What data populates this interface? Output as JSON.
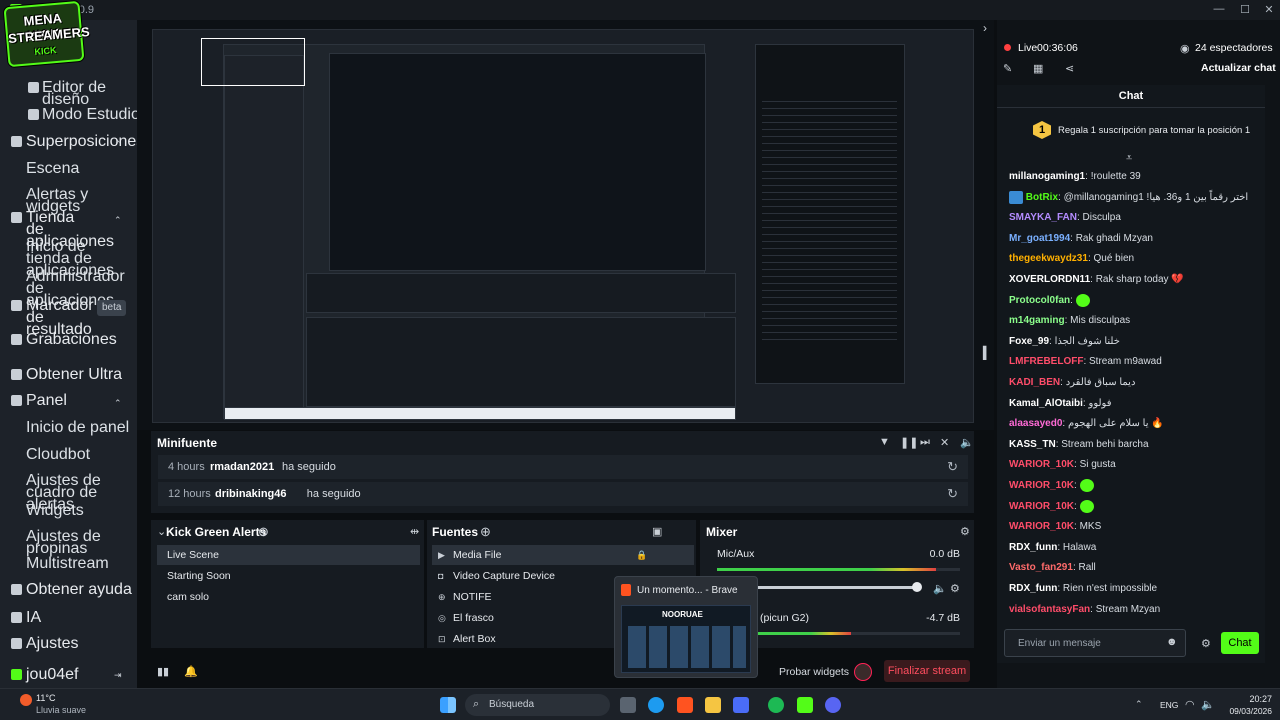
{
  "window": {
    "title": "St        pp - 1.20.9"
  },
  "logo": {
    "line1": "MENA KICK",
    "line2": "STREAMERS",
    "line3": "KICK"
  },
  "sidebar": {
    "items": [
      {
        "label": "Editor de diseño"
      },
      {
        "label": "Modo Estudio"
      },
      {
        "label": "Superposiciones"
      },
      {
        "label": "Escena"
      },
      {
        "label": "Alertas y widgets"
      },
      {
        "label": "Tienda de aplicaciones"
      },
      {
        "label": "Inicio de tienda de aplicaciones"
      },
      {
        "label": "Administrador de aplicaciones"
      },
      {
        "label": "Marcador de resultado"
      },
      {
        "label": "Grabaciones"
      },
      {
        "label": "Obtener Ultra"
      },
      {
        "label": "Panel"
      },
      {
        "label": "Inicio de panel"
      },
      {
        "label": "Cloudbot"
      },
      {
        "label": "Ajustes de cuadro de alertas"
      },
      {
        "label": "Widgets"
      },
      {
        "label": "Ajustes de propinas"
      },
      {
        "label": "Multistream"
      },
      {
        "label": "Obtener ayuda"
      },
      {
        "label": "IA"
      },
      {
        "label": "Ajustes"
      },
      {
        "label": "jou04ef"
      }
    ],
    "beta": "beta"
  },
  "minifeed": {
    "title": "Minifuente",
    "events": [
      {
        "time": "4 hours",
        "name": "rmadan2021",
        "action": "ha seguido"
      },
      {
        "time": "12 hours",
        "name": "dribinaking46",
        "action": "ha seguido"
      }
    ]
  },
  "scenes": {
    "title": "Kick Green Alerts",
    "items": [
      "Live Scene",
      "Starting Soon",
      "cam solo"
    ]
  },
  "sources": {
    "title": "Fuentes",
    "items": [
      "Media File",
      "Video Capture Device",
      "NOTIFE",
      "El frasco",
      "Alert Box"
    ]
  },
  "mixer": {
    "title": "Mixer",
    "channels": [
      {
        "name": "Mic/Aux",
        "db": "0.0 dB",
        "level": 0.9
      },
      {
        "name": "(picun G2)",
        "db": "-4.7 dB",
        "level": 0.55
      }
    ]
  },
  "footer": {
    "probar": "Probar widgets",
    "finalizar": "Finalizar stream"
  },
  "popup": {
    "title": "Un momento... - Brave",
    "thumb": "NOORUAE"
  },
  "live": {
    "label": "Live",
    "time": "00:36:06",
    "viewers": "24 espectadores",
    "update": "Actualizar chat"
  },
  "chat": {
    "title": "Chat",
    "sub_rank": "1",
    "sub_text": "Regala 1 suscripción para tomar la posición 1",
    "messages": [
      {
        "user": "millanogaming1",
        "color": "#ffffff",
        "text": "!roulette 39"
      },
      {
        "user": "BotRix",
        "color": "#53fc18",
        "text": "@millanogaming1 !اختر رقماً بين 1 و36. هيا"
      },
      {
        "user": "SMAYKA_FAN",
        "color": "#b48cff",
        "text": "Disculpa"
      },
      {
        "user": "Mr_goat1994",
        "color": "#7ab0ff",
        "text": "Rak ghadi Mzyan"
      },
      {
        "user": "thegeekwaydz31",
        "color": "#ffb000",
        "text": "Qué bien"
      },
      {
        "user": "XOVERLORDN11",
        "color": "#ffffff",
        "text": "Rak sharp today 💔"
      },
      {
        "user": "Protocol0fan",
        "color": "#8cff8c",
        "text": ""
      },
      {
        "user": "m14gaming",
        "color": "#8cff8c",
        "text": "Mis disculpas"
      },
      {
        "user": "Foxe_99",
        "color": "#ffffff",
        "text": "خلنا شوف الجذا"
      },
      {
        "user": "LMFREBELOFF",
        "color": "#ff4d6a",
        "text": "Stream m9awad"
      },
      {
        "user": "KADI_BEN",
        "color": "#ff4d6a",
        "text": "ديما سباق فالقرد"
      },
      {
        "user": "Kamal_AlOtaibi",
        "color": "#ffffff",
        "text": "فولوو"
      },
      {
        "user": "alaasayed0",
        "color": "#ff6bd6",
        "text": "يا سلام على الهجوم 🔥"
      },
      {
        "user": "KASS_TN",
        "color": "#ffffff",
        "text": "Stream behi barcha"
      },
      {
        "user": "WARIOR_10K",
        "color": "#ff4d6a",
        "text": "Si gusta"
      },
      {
        "user": "WARIOR_10K",
        "color": "#ff4d6a",
        "text": ""
      },
      {
        "user": "WARIOR_10K",
        "color": "#ff4d6a",
        "text": ""
      },
      {
        "user": "WARIOR_10K",
        "color": "#ff4d6a",
        "text": "MKS"
      },
      {
        "user": "RDX_funn",
        "color": "#ffffff",
        "text": "Halawa"
      },
      {
        "user": "Vasto_fan291",
        "color": "#ff6b6b",
        "text": "Rall"
      },
      {
        "user": "RDX_funn",
        "color": "#ffffff",
        "text": "Rien n'est impossible"
      },
      {
        "user": "vialsofantasyFan",
        "color": "#ff4d6a",
        "text": "Stream Mzyan"
      }
    ],
    "input_placeholder": "Enviar un mensaje",
    "send": "Chat"
  },
  "taskbar": {
    "weather": "11°C",
    "weather_desc": "Lluvia suave",
    "search": "Búsqueda",
    "lang": "ENG",
    "time": "20:27",
    "date": "09/03/2026"
  }
}
